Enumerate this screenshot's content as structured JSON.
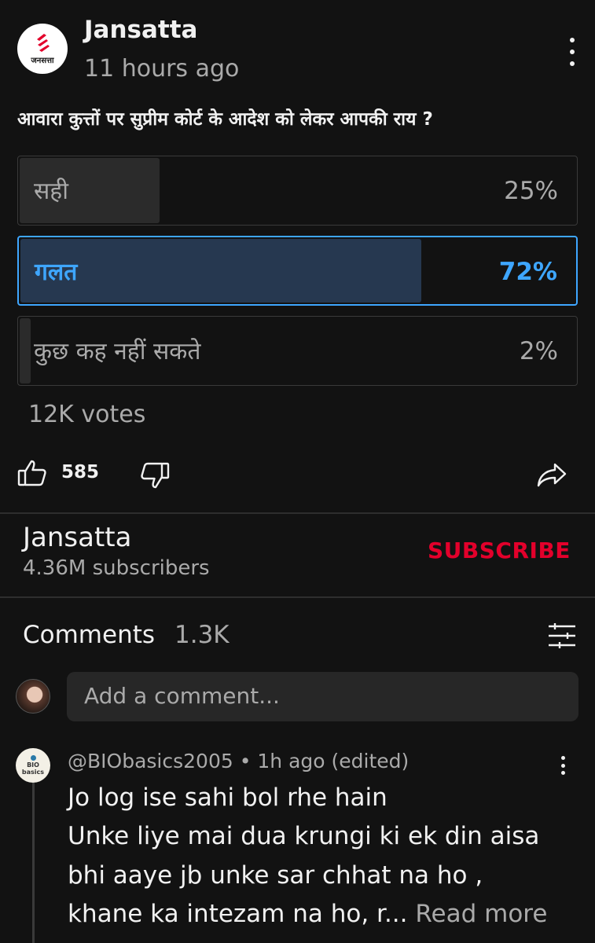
{
  "post": {
    "channel_name": "Jansatta",
    "logo_text": "जनसत्ता",
    "time_ago": "11 hours ago",
    "question": "आवारा कुत्तों पर सुप्रीम कोर्ट के आदेश को लेकर आपकी राय ?"
  },
  "poll": {
    "options": [
      {
        "label": "सही",
        "percent_text": "25%",
        "percent": 25,
        "selected": false
      },
      {
        "label": "गलत",
        "percent_text": "72%",
        "percent": 72,
        "selected": true
      },
      {
        "label": "कुछ कह नहीं सकते",
        "percent_text": "2%",
        "percent": 2,
        "selected": false
      }
    ],
    "votes": "12K votes"
  },
  "actions": {
    "like_count": "585"
  },
  "channel": {
    "name": "Jansatta",
    "subscribers": "4.36M subscribers",
    "subscribe_label": "SUBSCRIBE"
  },
  "comments": {
    "title": "Comments",
    "count": "1.3K",
    "add_placeholder": "Add a comment...",
    "items": [
      {
        "author_line": "@BIObasics2005 • 1h ago (edited)",
        "avatar_text": "BIO basics",
        "lines": [
          "Jo log ise sahi bol rhe hain",
          "Unke liye mai dua krungi ki ek din aisa",
          "bhi aaye jb unke sar chhat na ho ,",
          "khane ka intezam na ho, r..."
        ],
        "read_more": "Read more"
      }
    ]
  },
  "colors": {
    "background": "#121212",
    "accent_blue": "#3ea6ff",
    "subscribe_red": "#e3002b",
    "secondary_text": "#aaaaaa"
  }
}
